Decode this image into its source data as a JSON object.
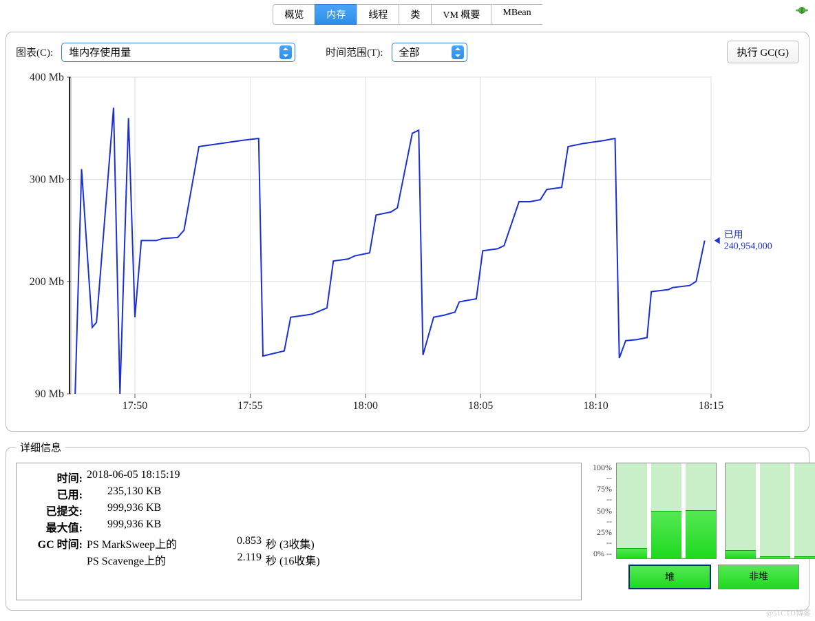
{
  "tabs": [
    "概览",
    "内存",
    "线程",
    "类",
    "VM 概要",
    "MBean"
  ],
  "active_tab_index": 1,
  "controls": {
    "chart_label": "图表(C):",
    "chart_value": "堆内存使用量",
    "time_label": "时间范围(T):",
    "time_value": "全部",
    "gc_button": "执行 GC(G)"
  },
  "details": {
    "legend": "详细信息",
    "time_label": "时间:",
    "time_value": "2018-06-05 18:15:19",
    "used_label": "已用:",
    "used_value": "235,130 KB",
    "committed_label": "已提交:",
    "committed_value": "999,936 KB",
    "max_label": "最大值:",
    "max_value": "999,936 KB",
    "gc_label": "GC 时间:",
    "gc1_collector": "PS MarkSweep上的",
    "gc1_seconds": "0.853",
    "gc1_suffix": "秒 (3收集)",
    "gc2_collector": "PS Scavenge上的",
    "gc2_seconds": "2.119",
    "gc2_suffix": "秒 (16收集)"
  },
  "mini": {
    "ticks": [
      "100% --",
      "75% --",
      "50% --",
      "25% --",
      "0% --"
    ],
    "heap_bars_pct": [
      11,
      50,
      51
    ],
    "nonheap_bars_pct": [
      9,
      2,
      2
    ],
    "heap_label": "堆",
    "nonheap_label": "非堆"
  },
  "marker": {
    "label": "已用",
    "value": "240,954,000"
  },
  "watermark": "@51CTO博客",
  "chart_data": {
    "type": "line",
    "title": "",
    "xlabel": "",
    "ylabel": "",
    "y_unit": "Mb",
    "y_ticks": [
      90,
      200,
      300,
      400
    ],
    "x_ticks": [
      "17:50",
      "17:55",
      "18:00",
      "18:05",
      "18:10",
      "18:15"
    ],
    "x_range": [
      0,
      30
    ],
    "y_range": [
      90,
      400
    ],
    "series": [
      {
        "name": "已用",
        "color": "#1a2fd6",
        "points": [
          [
            0.2,
            90
          ],
          [
            0.5,
            310
          ],
          [
            1.0,
            155
          ],
          [
            1.2,
            160
          ],
          [
            2.0,
            370
          ],
          [
            2.3,
            90
          ],
          [
            2.7,
            360
          ],
          [
            3.0,
            165
          ],
          [
            3.3,
            240
          ],
          [
            4.0,
            240
          ],
          [
            4.3,
            242
          ],
          [
            5.0,
            243
          ],
          [
            5.3,
            250
          ],
          [
            6.0,
            332
          ],
          [
            7.0,
            335
          ],
          [
            8.0,
            338
          ],
          [
            8.8,
            340
          ],
          [
            9.0,
            127
          ],
          [
            9.6,
            130
          ],
          [
            10.0,
            132
          ],
          [
            10.3,
            165
          ],
          [
            11.0,
            167
          ],
          [
            11.3,
            168
          ],
          [
            12.0,
            174
          ],
          [
            12.3,
            220
          ],
          [
            13.0,
            222
          ],
          [
            13.3,
            225
          ],
          [
            14.0,
            228
          ],
          [
            14.3,
            265
          ],
          [
            15.0,
            268
          ],
          [
            15.3,
            272
          ],
          [
            16.0,
            345
          ],
          [
            16.3,
            348
          ],
          [
            16.5,
            128
          ],
          [
            17.0,
            165
          ],
          [
            17.5,
            167
          ],
          [
            18.0,
            170
          ],
          [
            18.2,
            180
          ],
          [
            19.0,
            183
          ],
          [
            19.3,
            230
          ],
          [
            20.0,
            232
          ],
          [
            20.3,
            235
          ],
          [
            21.0,
            278
          ],
          [
            21.5,
            278
          ],
          [
            22.0,
            280
          ],
          [
            22.3,
            290
          ],
          [
            23.0,
            292
          ],
          [
            23.3,
            332
          ],
          [
            24.0,
            335
          ],
          [
            25.0,
            338
          ],
          [
            25.5,
            340
          ],
          [
            25.7,
            125
          ],
          [
            26.0,
            142
          ],
          [
            26.5,
            143
          ],
          [
            27.0,
            145
          ],
          [
            27.2,
            190
          ],
          [
            28.0,
            192
          ],
          [
            28.2,
            194
          ],
          [
            29.0,
            196
          ],
          [
            29.3,
            200
          ],
          [
            29.7,
            240
          ]
        ]
      }
    ],
    "current_marker": {
      "x": 29.7,
      "y": 240
    }
  }
}
